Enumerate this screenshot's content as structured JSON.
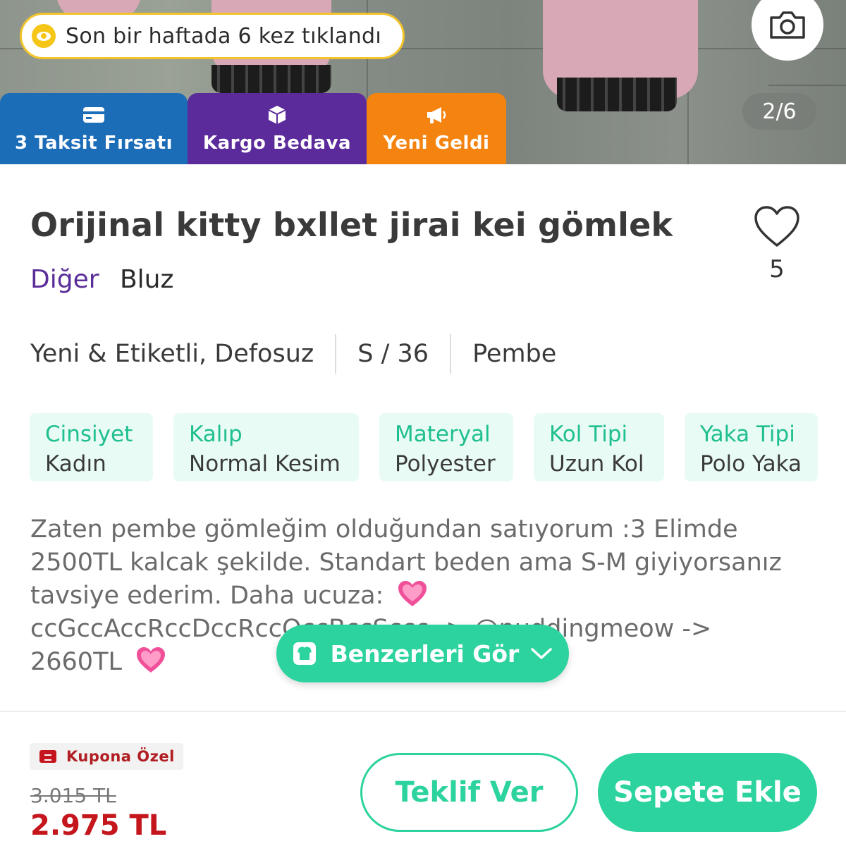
{
  "header": {
    "click_notice": "Son bir haftada 6 kez tıklandı",
    "page_indicator": "2/6",
    "badges": {
      "taksit": "3 Taksit Fırsatı",
      "kargo": "Kargo Bedava",
      "yeni": "Yeni Geldi"
    }
  },
  "product": {
    "title": "Orijinal kitty bxllet jirai kei gömlek",
    "brand": "Diğer",
    "category": "Bluz",
    "favorite_count": "5",
    "condition": "Yeni & Etiketli, Defosuz",
    "size": "S / 36",
    "color": "Pembe",
    "chips": [
      {
        "key": "Cinsiyet",
        "value": "Kadın"
      },
      {
        "key": "Kalıp",
        "value": "Normal Kesim"
      },
      {
        "key": "Materyal",
        "value": "Polyester"
      },
      {
        "key": "Kol Tipi",
        "value": "Uzun Kol"
      },
      {
        "key": "Yaka Tipi",
        "value": "Polo Yaka"
      }
    ],
    "description": {
      "line1": "Zaten pembe gömleğim olduğundan satıyorum :3 Elimde",
      "line2": "2500TL kalcak şekilde. Standart beden ama S-M giyiyorsanız",
      "line3": "tavsiye ederim. Daha ucuza:",
      "line4": "ccGccAccRccDccRccOccBccSccc -> @puddingmeow ->",
      "line5": "2660TL"
    }
  },
  "similar_button": "Benzerleri Gör",
  "bottom": {
    "coupon": "Kupona Özel",
    "old_price": "3.015 TL",
    "price": "2.975 TL",
    "offer_button": "Teklif Ver",
    "cart_button": "Sepete Ekle"
  },
  "colors": {
    "accent_green": "#2cd39e",
    "price_red": "#c4161c",
    "brand_purple": "#5a2d99",
    "taksit_blue": "#1b6db8",
    "kargo_purple": "#5b2b9b",
    "yeni_orange": "#f5830f"
  },
  "icons": [
    "eye-icon",
    "camera-icon",
    "credit-card-icon",
    "box-icon",
    "megaphone-icon",
    "heart-icon",
    "sparkling-heart-emoji",
    "tshirt-icon",
    "chevron-down-icon",
    "coupon-ticket-icon"
  ]
}
